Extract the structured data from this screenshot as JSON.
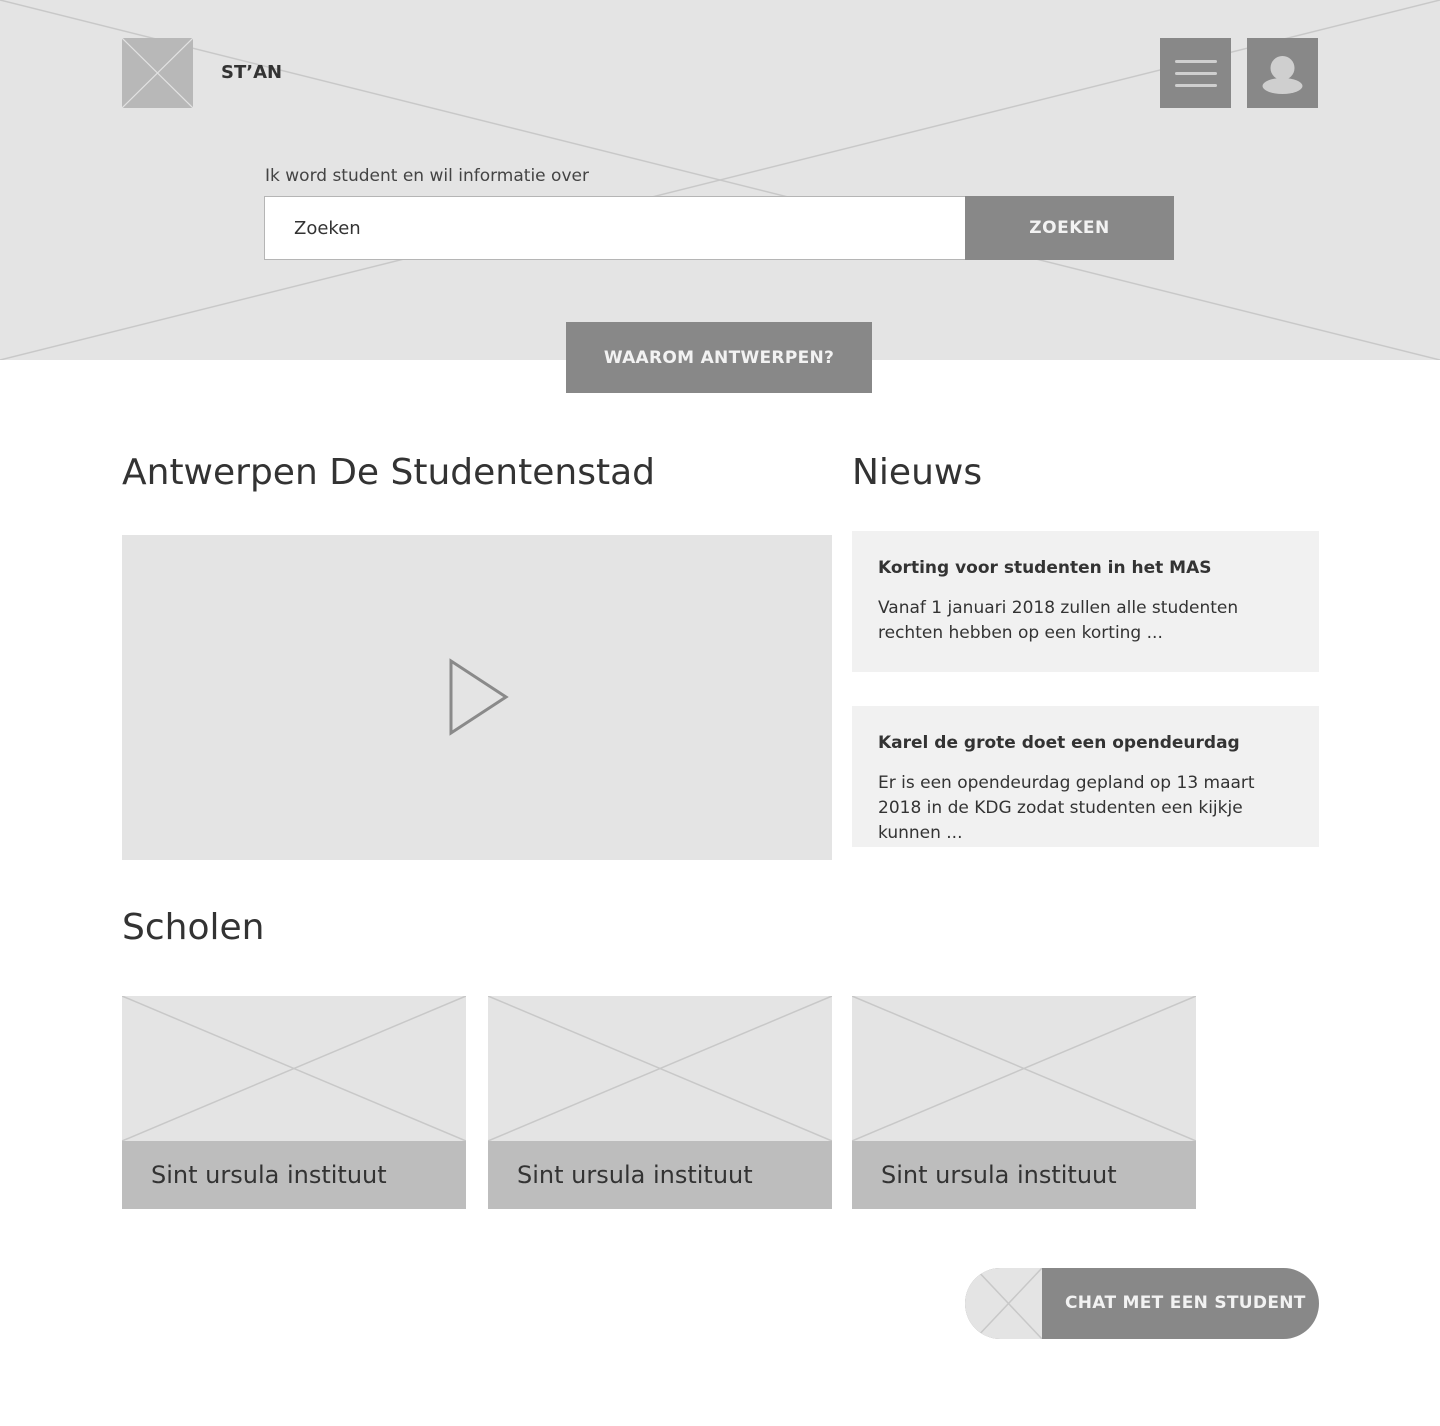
{
  "header": {
    "brand": "ST’AN",
    "logo_icon": "placeholder-image-icon",
    "menu_icon": "hamburger-menu-icon",
    "user_icon": "user-avatar-icon"
  },
  "search": {
    "label": "Ik word student en wil informatie over",
    "placeholder": "Zoeken",
    "value": "",
    "button_label": "ZOEKEN"
  },
  "why_button": {
    "label": "WAAROM ANTWERPEN?"
  },
  "city_section": {
    "title": "Antwerpen De Studentenstad",
    "video_icon": "play-icon"
  },
  "news_section": {
    "title": "Nieuws",
    "items": [
      {
        "title": "Korting voor studenten in het MAS",
        "body": "Vanaf 1 januari 2018 zullen alle studenten rechten hebben op een korting ..."
      },
      {
        "title": "Karel de grote doet een opendeurdag",
        "body": "Er is een opendeurdag gepland op 13 maart 2018 in de KDG zodat studenten een kijkje kunnen ..."
      }
    ]
  },
  "schools_section": {
    "title": "Scholen",
    "items": [
      {
        "name": "Sint ursula instituut"
      },
      {
        "name": "Sint ursula instituut"
      },
      {
        "name": "Sint ursula instituut"
      }
    ]
  },
  "chat": {
    "label": "CHAT MET EEN STUDENT",
    "avatar_icon": "placeholder-image-icon"
  },
  "colors": {
    "placeholder_bg": "#e4e4e4",
    "button_bg": "#888888",
    "card_bg": "#f1f1f1",
    "caption_bg": "#bdbdbd",
    "text": "#333333"
  }
}
